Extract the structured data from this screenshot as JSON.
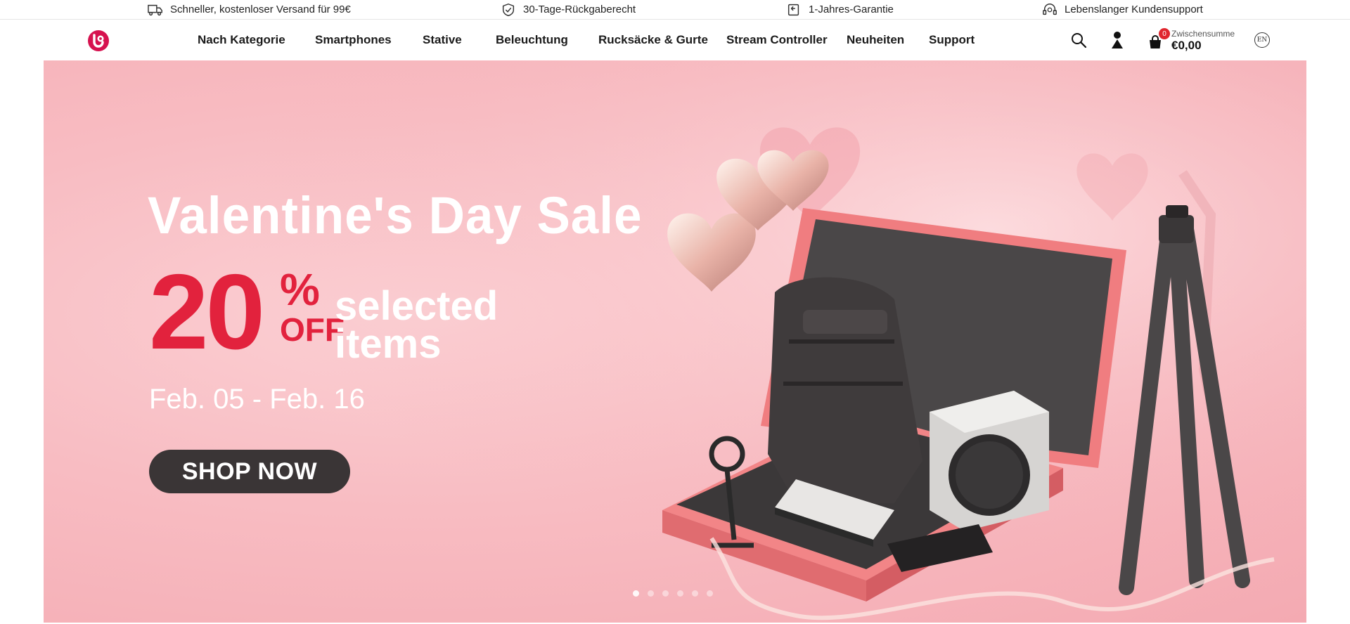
{
  "topbar": {
    "items": [
      {
        "icon": "truck-icon",
        "text": "Schneller, kostenloser Versand für 99€"
      },
      {
        "icon": "shield-check-icon",
        "text": "30-Tage-Rückgaberecht"
      },
      {
        "icon": "return-box-icon",
        "text": "1-Jahres-Garantie"
      },
      {
        "icon": "headset-icon",
        "text": "Lebenslanger Kundensupport"
      }
    ]
  },
  "header": {
    "nav": [
      "Nach Kategorie",
      "Smartphones",
      "Stative",
      "Beleuchtung",
      "Rucksäcke & Gurte",
      "Stream Controller",
      "Neuheiten",
      "Support"
    ],
    "cart": {
      "count": "0",
      "label": "Zwischensumme",
      "value": "€0,00"
    },
    "language": "EN"
  },
  "hero": {
    "title": "Valentine's Day Sale",
    "discount": "20",
    "percent": "%",
    "off": "OFF",
    "selected": "selected",
    "items": "items",
    "dates": "Feb. 05 - Feb. 16",
    "cta": "SHOP NOW",
    "slide_count": 6,
    "active_slide": 1
  },
  "colors": {
    "accent": "#e2223d",
    "brand": "#d6124f",
    "hero_bg": "#f8bcc2",
    "button_dark": "#3a3536"
  }
}
